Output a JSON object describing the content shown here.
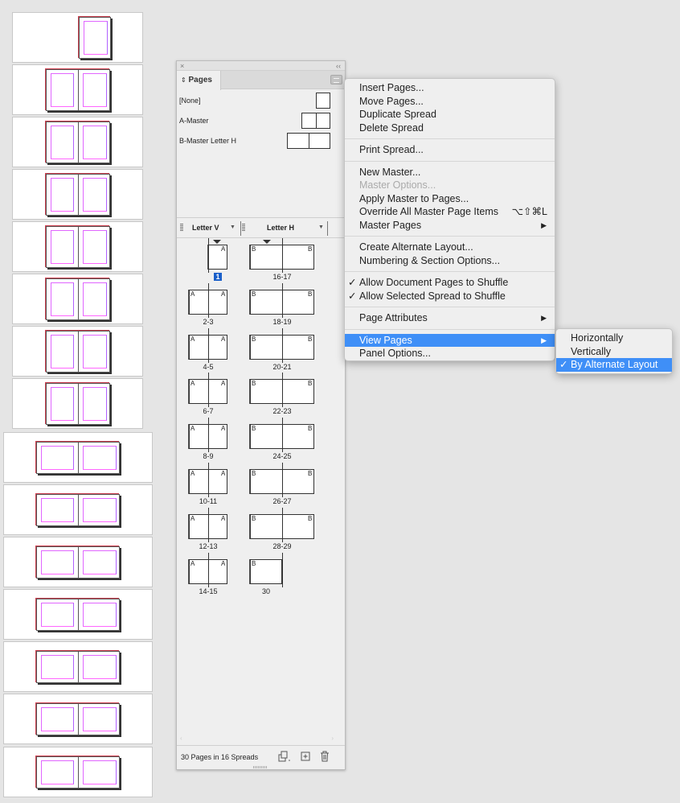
{
  "canvas": {
    "thumbnails": [
      {
        "type": "single"
      },
      {
        "type": "portrait-spread"
      },
      {
        "type": "portrait-spread"
      },
      {
        "type": "portrait-spread"
      },
      {
        "type": "portrait-spread"
      },
      {
        "type": "portrait-spread"
      },
      {
        "type": "portrait-spread"
      },
      {
        "type": "portrait-spread"
      },
      {
        "type": "landscape-spread"
      },
      {
        "type": "landscape-spread"
      },
      {
        "type": "landscape-spread"
      },
      {
        "type": "landscape-spread"
      },
      {
        "type": "landscape-spread"
      },
      {
        "type": "landscape-spread"
      },
      {
        "type": "landscape-spread"
      }
    ],
    "colors": {
      "page_border": "#555555",
      "margin_guide": "#e066ff",
      "bleed": "#d04050"
    }
  },
  "panel": {
    "close_icon": "×",
    "collapse_icon": "‹‹",
    "tab_label": "Pages",
    "tab_icon": "⇕",
    "masters": [
      {
        "label": "[None]",
        "pages": 1,
        "orientation": "portrait"
      },
      {
        "label": "A-Master",
        "pages": 2,
        "orientation": "portrait"
      },
      {
        "label": "B-Master Letter H",
        "pages": 2,
        "orientation": "landscape"
      }
    ],
    "columns": [
      {
        "label": "Letter V"
      },
      {
        "label": "Letter H"
      }
    ],
    "spreads_v": [
      {
        "label": "1",
        "master": "A",
        "pages": 1,
        "selected": true,
        "shuffle_marker": true
      },
      {
        "label": "2-3",
        "master": "A",
        "pages": 2
      },
      {
        "label": "4-5",
        "master": "A",
        "pages": 2
      },
      {
        "label": "6-7",
        "master": "A",
        "pages": 2
      },
      {
        "label": "8-9",
        "master": "A",
        "pages": 2
      },
      {
        "label": "10-11",
        "master": "A",
        "pages": 2
      },
      {
        "label": "12-13",
        "master": "A",
        "pages": 2
      },
      {
        "label": "14-15",
        "master": "A",
        "pages": 2
      }
    ],
    "spreads_h": [
      {
        "label": "16-17",
        "master": "B",
        "pages": 2,
        "shuffle_marker": true
      },
      {
        "label": "18-19",
        "master": "B",
        "pages": 2
      },
      {
        "label": "20-21",
        "master": "B",
        "pages": 2
      },
      {
        "label": "22-23",
        "master": "B",
        "pages": 2
      },
      {
        "label": "24-25",
        "master": "B",
        "pages": 2
      },
      {
        "label": "26-27",
        "master": "B",
        "pages": 2
      },
      {
        "label": "28-29",
        "master": "B",
        "pages": 2
      },
      {
        "label": "30",
        "master": "B",
        "pages": 1
      }
    ],
    "footer": {
      "status": "30 Pages in 16 Spreads",
      "edit_page_size_icon": "page-size-icon",
      "new_page_icon": "new-page-icon",
      "delete_icon": "trash-icon"
    },
    "selection_color": "#1a5fc9"
  },
  "menu": {
    "groups": [
      [
        {
          "label": "Insert Pages..."
        },
        {
          "label": "Move Pages..."
        },
        {
          "label": "Duplicate Spread"
        },
        {
          "label": "Delete Spread"
        }
      ],
      [
        {
          "label": "Print Spread..."
        }
      ],
      [
        {
          "label": "New Master..."
        },
        {
          "label": "Master Options...",
          "disabled": true
        },
        {
          "label": "Apply Master to Pages..."
        },
        {
          "label": "Override All Master Page Items",
          "shortcut": "⌥⇧⌘L"
        },
        {
          "label": "Master Pages",
          "submenu": true
        }
      ],
      [
        {
          "label": "Create Alternate Layout..."
        },
        {
          "label": "Numbering & Section Options..."
        }
      ],
      [
        {
          "label": "Allow Document Pages to Shuffle",
          "checked": true
        },
        {
          "label": "Allow Selected Spread to Shuffle",
          "checked": true
        }
      ],
      [
        {
          "label": "Page Attributes",
          "submenu": true
        }
      ],
      [
        {
          "label": "View Pages",
          "submenu": true,
          "active": true
        },
        {
          "label": "Panel Options..."
        }
      ]
    ],
    "highlight_color": "#3f8ff7"
  },
  "submenu": {
    "items": [
      {
        "label": "Horizontally"
      },
      {
        "label": "Vertically"
      },
      {
        "label": "By Alternate Layout",
        "checked": true,
        "active": true
      }
    ]
  }
}
